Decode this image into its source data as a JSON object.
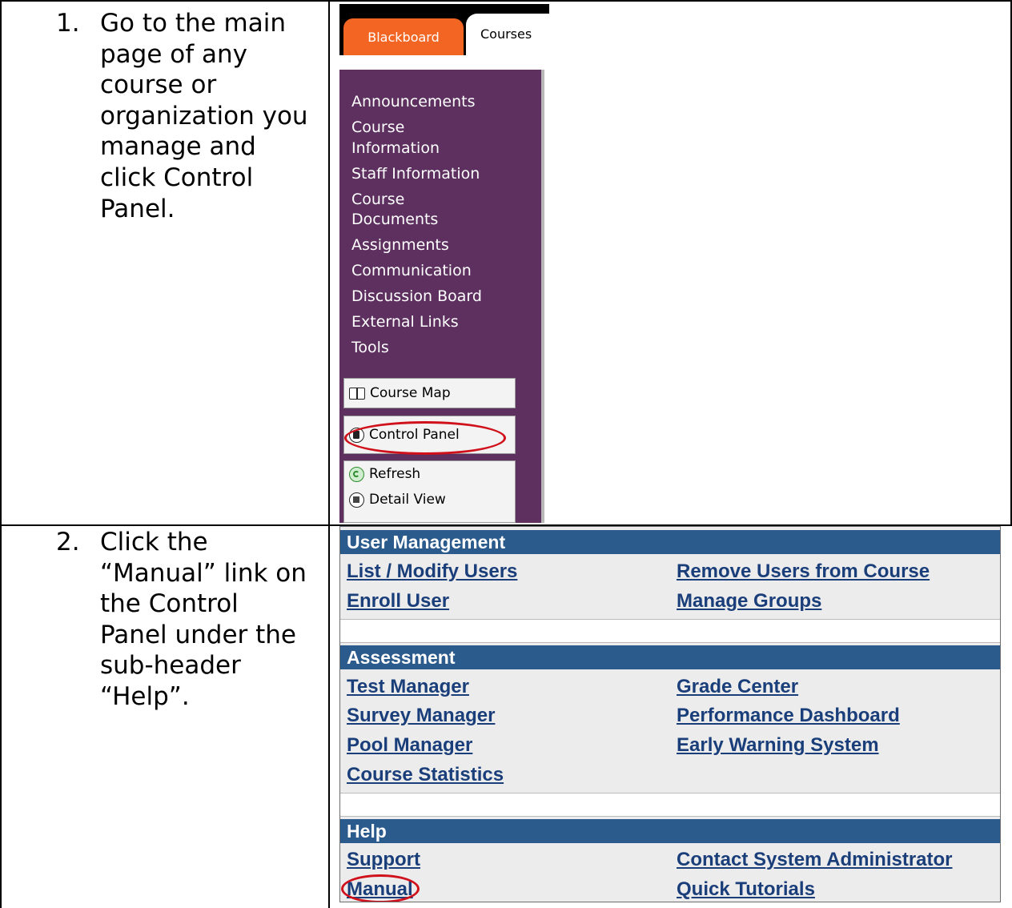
{
  "steps": [
    {
      "number": "1.",
      "text": "Go to the main\npage of any\ncourse or\norganization you\nmanage and\nclick Control\nPanel."
    },
    {
      "number": "2.",
      "text": "Click the\n“Manual” link on\nthe Control\nPanel under the\nsub-header\n“Help”."
    }
  ],
  "bb_menu": {
    "tabs": [
      "Blackboard",
      "Courses"
    ],
    "nav": [
      "Announcements",
      "Course\nInformation",
      "Staff Information",
      "Course\nDocuments",
      "Assignments",
      "Communication",
      "Discussion Board",
      "External Links",
      "Tools"
    ],
    "course_map": "Course Map",
    "control_panel": "Control Panel",
    "refresh": "Refresh",
    "detail_view": "Detail View"
  },
  "control_panel": {
    "sections": [
      {
        "title": "User Management",
        "links": [
          "List / Modify Users",
          "Remove Users from Course",
          "Enroll User",
          "Manage Groups"
        ]
      },
      {
        "title": "Assessment",
        "links": [
          "Test Manager",
          "Grade Center",
          "Survey Manager",
          "Performance Dashboard",
          "Pool Manager",
          "Early Warning System",
          "Course Statistics"
        ]
      },
      {
        "title": "Help",
        "links": [
          "Support",
          "Contact System Administrator",
          "Manual",
          "Quick Tutorials"
        ]
      }
    ]
  },
  "colors": {
    "purple_menu": "#5d3060",
    "orange_tab": "#f26522",
    "header_blue": "#2b5a8c",
    "link_blue": "#1a3e7a",
    "highlight_red": "#d0101a"
  }
}
